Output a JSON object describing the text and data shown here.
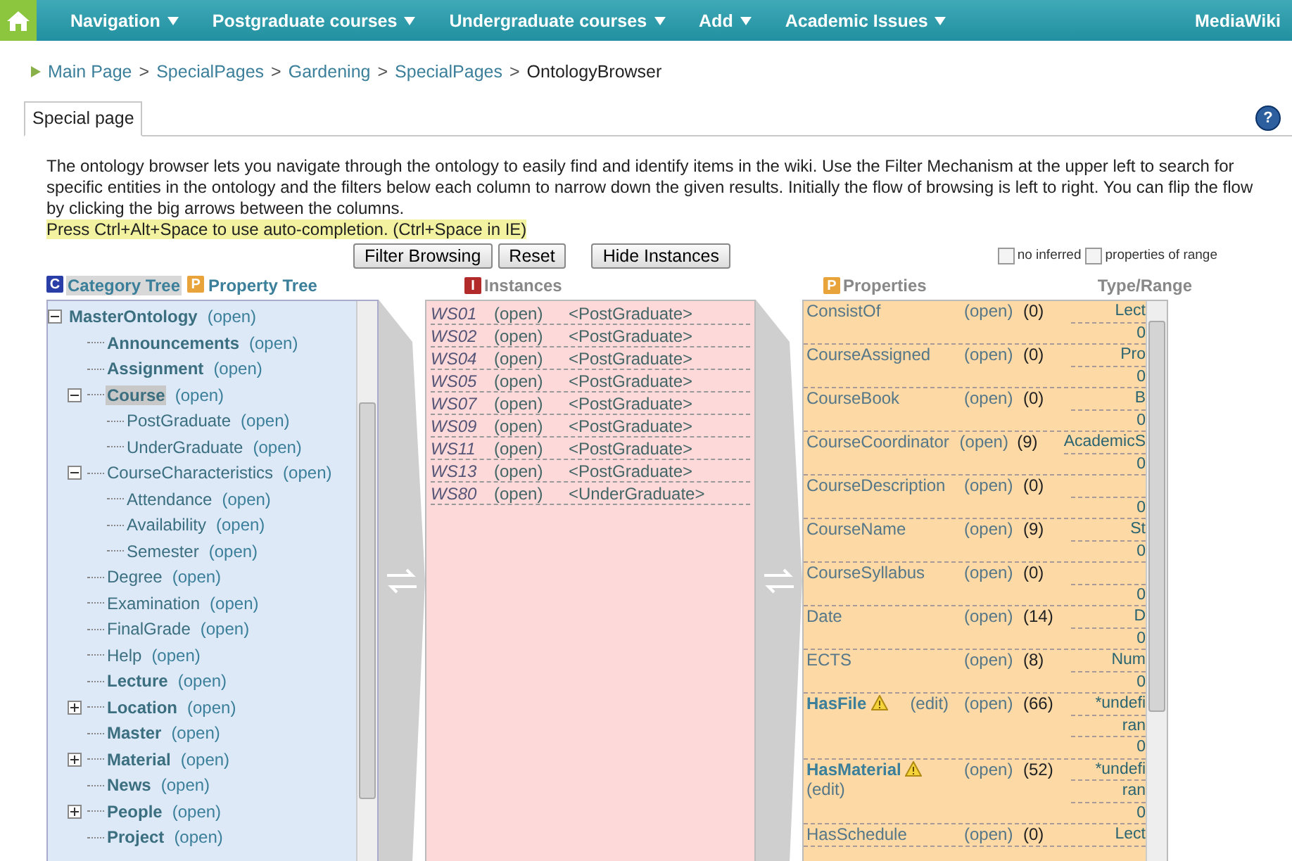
{
  "navbar": {
    "menus": [
      {
        "label": "Navigation"
      },
      {
        "label": "Postgraduate courses"
      },
      {
        "label": "Undergraduate courses"
      },
      {
        "label": "Add"
      },
      {
        "label": "Academic Issues"
      }
    ],
    "site": "MediaWiki"
  },
  "breadcrumb": {
    "separator": ">",
    "items": [
      {
        "label": "Main Page",
        "current": false
      },
      {
        "label": "SpecialPages",
        "current": false
      },
      {
        "label": "Gardening",
        "current": false
      },
      {
        "label": "SpecialPages",
        "current": false
      },
      {
        "label": "OntologyBrowser",
        "current": true
      }
    ]
  },
  "page_tab": {
    "label": "Special page"
  },
  "help": "?",
  "description": "The ontology browser lets you navigate through the ontology to easily find and identify items in the wiki. Use the Filter Mechanism at the upper left to search for specific entities in the ontology and the filters below each column to narrow down the given results. Initially the flow of browsing is left to right. You can flip the flow by clicking the big arrows between the columns.",
  "hint": "Press Ctrl+Alt+Space to use auto-completion. (Ctrl+Space in IE)",
  "buttons": [
    "Filter Browsing",
    "Reset",
    "Hide Instances"
  ],
  "options": [
    {
      "label": "no inferred",
      "checked": false
    },
    {
      "label": "properties of range",
      "checked": false
    }
  ],
  "tree_tabs": [
    {
      "badge": "C",
      "label": "Category Tree",
      "selected": true
    },
    {
      "badge": "P",
      "label": "Property Tree",
      "selected": false
    }
  ],
  "tree": [
    {
      "name": "MasterOntology",
      "status": "(open)",
      "bold": true,
      "selected": false,
      "expanded": true,
      "children": [
        {
          "name": "Announcements",
          "status": "(open)",
          "bold": true,
          "selected": false
        },
        {
          "name": "Assignment",
          "status": "(open)",
          "bold": true,
          "selected": false
        },
        {
          "name": "Course",
          "status": "(open)",
          "bold": true,
          "selected": true,
          "expanded": true,
          "children": [
            {
              "name": "PostGraduate",
              "status": "(open)",
              "bold": false,
              "selected": false
            },
            {
              "name": "UnderGraduate",
              "status": "(open)",
              "bold": false,
              "selected": false
            }
          ]
        },
        {
          "name": "CourseCharacteristics",
          "status": "(open)",
          "bold": false,
          "selected": false,
          "expanded": true,
          "children": [
            {
              "name": "Attendance",
              "status": "(open)",
              "bold": false,
              "selected": false
            },
            {
              "name": "Availability",
              "status": "(open)",
              "bold": false,
              "selected": false
            },
            {
              "name": "Semester",
              "status": "(open)",
              "bold": false,
              "selected": false
            }
          ]
        },
        {
          "name": "Degree",
          "status": "(open)",
          "bold": false,
          "selected": false
        },
        {
          "name": "Examination",
          "status": "(open)",
          "bold": false,
          "selected": false
        },
        {
          "name": "FinalGrade",
          "status": "(open)",
          "bold": false,
          "selected": false
        },
        {
          "name": "Help",
          "status": "(open)",
          "bold": false,
          "selected": false
        },
        {
          "name": "Lecture",
          "status": "(open)",
          "bold": true,
          "selected": false
        },
        {
          "name": "Location",
          "status": "(open)",
          "bold": true,
          "selected": false,
          "expanded": false
        },
        {
          "name": "Master",
          "status": "(open)",
          "bold": true,
          "selected": false
        },
        {
          "name": "Material",
          "status": "(open)",
          "bold": true,
          "selected": false,
          "expanded": false
        },
        {
          "name": "News",
          "status": "(open)",
          "bold": true,
          "selected": false
        },
        {
          "name": "People",
          "status": "(open)",
          "bold": true,
          "selected": false,
          "expanded": false
        },
        {
          "name": "Project",
          "status": "(open)",
          "bold": true,
          "selected": false
        }
      ]
    }
  ],
  "instances": {
    "badge": "I",
    "title": "Instances",
    "rows": [
      {
        "name": "WS01",
        "status": "(open)",
        "category": "<PostGraduate>"
      },
      {
        "name": "WS02",
        "status": "(open)",
        "category": "<PostGraduate>"
      },
      {
        "name": "WS04",
        "status": "(open)",
        "category": "<PostGraduate>"
      },
      {
        "name": "WS05",
        "status": "(open)",
        "category": "<PostGraduate>"
      },
      {
        "name": "WS07",
        "status": "(open)",
        "category": "<PostGraduate>"
      },
      {
        "name": "WS09",
        "status": "(open)",
        "category": "<PostGraduate>"
      },
      {
        "name": "WS11",
        "status": "(open)",
        "category": "<PostGraduate>"
      },
      {
        "name": "WS13",
        "status": "(open)",
        "category": "<PostGraduate>"
      },
      {
        "name": "WS80",
        "status": "(open)",
        "category": "<UnderGraduate>"
      }
    ]
  },
  "properties": {
    "badge": "P",
    "title": "Properties",
    "type_heading": "Type/Range",
    "rows": [
      {
        "name": "ConsistOf",
        "bold": false,
        "warning": false,
        "status": "(open)",
        "count": "(0)",
        "range": [
          "Lect"
        ],
        "cardinality": "0"
      },
      {
        "name": "CourseAssigned",
        "bold": false,
        "warning": false,
        "status": "(open)",
        "count": "(0)",
        "range": [
          "Pro"
        ],
        "cardinality": "0"
      },
      {
        "name": "CourseBook",
        "bold": false,
        "warning": false,
        "status": "(open)",
        "count": "(0)",
        "range": [
          "B"
        ],
        "cardinality": "0"
      },
      {
        "name": "CourseCoordinator",
        "bold": false,
        "warning": false,
        "status": "(open)",
        "count": "(9)",
        "range": [
          "AcademicS"
        ],
        "cardinality": "0"
      },
      {
        "name": "CourseDescription",
        "bold": false,
        "warning": false,
        "status": "(open)",
        "count": "(0)",
        "cardinality": "0"
      },
      {
        "name": "CourseName",
        "bold": false,
        "warning": false,
        "status": "(open)",
        "count": "(9)",
        "range": [
          "St"
        ],
        "cardinality": "0"
      },
      {
        "name": "CourseSyllabus",
        "bold": false,
        "warning": false,
        "status": "(open)",
        "count": "(0)",
        "cardinality": "0"
      },
      {
        "name": "Date",
        "bold": false,
        "warning": false,
        "status": "(open)",
        "count": "(14)",
        "range": [
          "D"
        ],
        "cardinality": "0"
      },
      {
        "name": "ECTS",
        "bold": false,
        "warning": false,
        "status": "(open)",
        "count": "(8)",
        "range": [
          "Num"
        ],
        "cardinality": "0"
      },
      {
        "name": "HasFile",
        "bold": true,
        "warning": true,
        "edit": "(edit)",
        "edit_wrapped": false,
        "status": "(open)",
        "count": "(66)",
        "range": [
          "*undefi",
          "ran"
        ],
        "cardinality": "0"
      },
      {
        "name": "HasMaterial",
        "bold": true,
        "warning": true,
        "edit": "(edit)",
        "edit_wrapped": true,
        "status": "(open)",
        "count": "(52)",
        "range": [
          "*undefi",
          "ran"
        ],
        "cardinality": "0"
      },
      {
        "name": "HasSchedule",
        "bold": false,
        "warning": false,
        "status": "(open)",
        "count": "(0)",
        "range": [
          "Lect"
        ]
      }
    ]
  }
}
